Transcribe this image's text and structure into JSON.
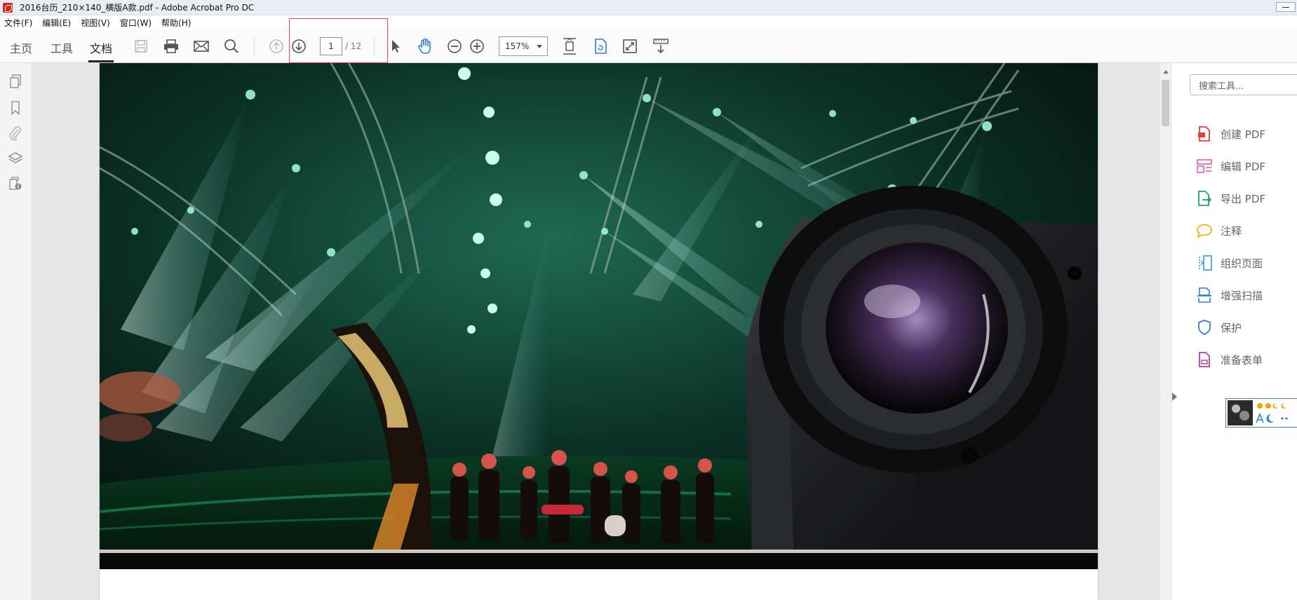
{
  "window": {
    "title": "2016台历_210×140_横版A款.pdf - Adobe Acrobat Pro DC"
  },
  "menubar": [
    {
      "label": "文件(F)"
    },
    {
      "label": "编辑(E)"
    },
    {
      "label": "视图(V)"
    },
    {
      "label": "窗口(W)"
    },
    {
      "label": "帮助(H)"
    }
  ],
  "tabs": [
    {
      "label": "主页"
    },
    {
      "label": "工具"
    },
    {
      "label": "文档",
      "active": true
    }
  ],
  "navigation": {
    "current_page": "1",
    "total_pages": "/ 12"
  },
  "zoom": {
    "value": "157%"
  },
  "search": {
    "placeholder": "搜索工具..."
  },
  "tools": [
    {
      "label": "创建 PDF",
      "icon": "create-pdf-icon",
      "color": "#e0403a"
    },
    {
      "label": "编辑 PDF",
      "icon": "edit-pdf-icon",
      "color": "#e15ab8"
    },
    {
      "label": "导出 PDF",
      "icon": "export-pdf-icon",
      "color": "#28a55f"
    },
    {
      "label": "注释",
      "icon": "comment-icon",
      "color": "#f2b311"
    },
    {
      "label": "组织页面",
      "icon": "organize-pages-icon",
      "color": "#2e9fe0"
    },
    {
      "label": "增强扫描",
      "icon": "enhance-scan-icon",
      "color": "#2e7fd6"
    },
    {
      "label": "保护",
      "icon": "protect-icon",
      "color": "#2e7fd6"
    },
    {
      "label": "准备表单",
      "icon": "prepare-form-icon",
      "color": "#b43c9e"
    }
  ],
  "colors": {
    "accent": "#2e7fd6",
    "highlight_box": "#e5484d"
  }
}
